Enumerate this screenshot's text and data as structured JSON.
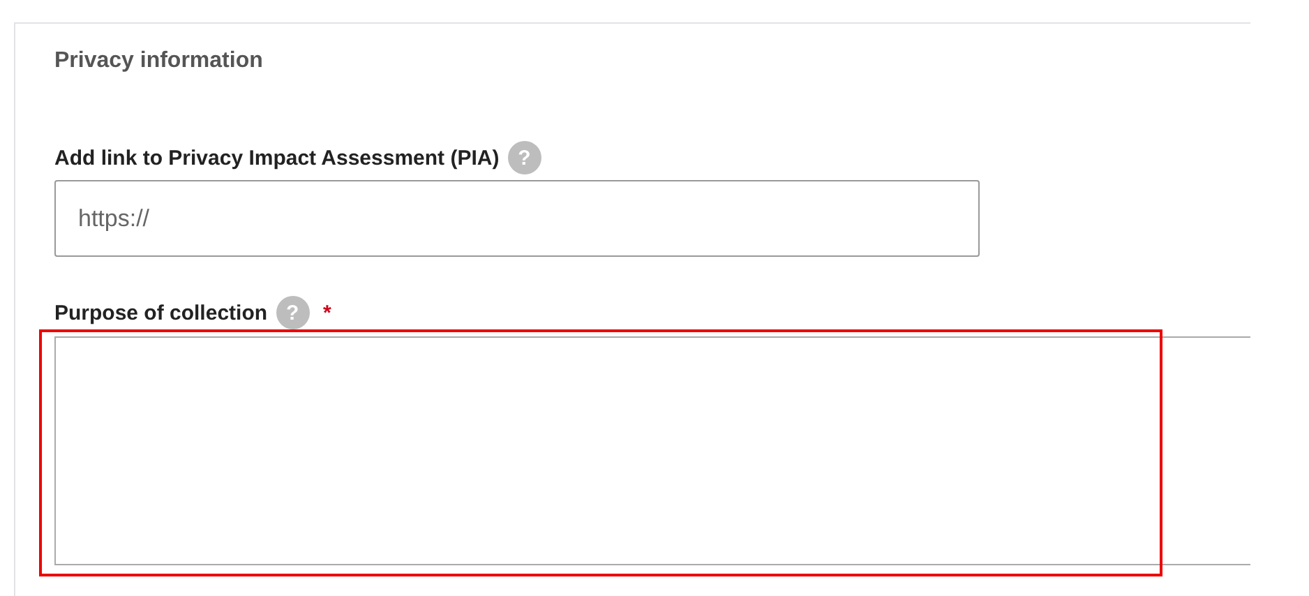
{
  "section": {
    "title": "Privacy information"
  },
  "fields": [
    {
      "kind": "input",
      "label": "Add link to Privacy Impact Assessment (PIA)",
      "help_icon": "?",
      "placeholder": "https://"
    },
    {
      "kind": "textarea",
      "label": "Purpose of collection",
      "help_icon": "?",
      "required_mark": "*",
      "highlighted": true
    }
  ]
}
